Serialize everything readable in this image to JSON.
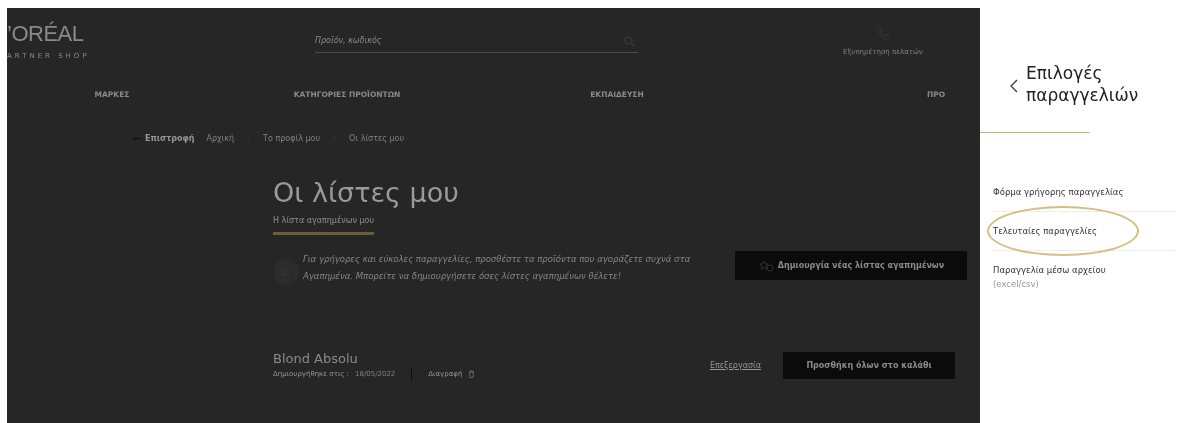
{
  "page": {
    "logo": {
      "brand": "’ORÉAL",
      "subtitle": "ARTNER SHOP"
    },
    "search": {
      "placeholder": "Προϊόν, κωδικός"
    },
    "customer_service": "Εξυπηρέτηση πελατών",
    "nav": [
      "ΜΑΡΚΕΣ",
      "ΚΑΤΗΓΟΡΙΕΣ ΠΡΟΪΟΝΤΩΝ",
      "ΕΚΠΑΙΔΕΥΣΗ",
      "ΠΡΟ"
    ],
    "back": "Επιστροφή",
    "breadcrumb": [
      "Αρχική",
      "Το προφίλ μου",
      "Οι λίστες μου"
    ],
    "title": "Οι λίστες μου",
    "tabs": [
      {
        "label": "Η λίστα αγαπημένων μου",
        "selected": true
      }
    ],
    "info": "Για γρήγορες και εύκολες παραγγελίες, προσθέστε τα προϊόντα που αγοράζετε συχνά στα Αγαπημένα. Μπορείτε να δημιουργήσετε όσες λίστες αγαπημένων θέλετε!",
    "create_button": "Δημιουργία νέας λίστας αγαπημένων",
    "lists": [
      {
        "name": "Blond Absolu",
        "created_label": "Δημιουργήθηκε στις :",
        "created_date": "18/05/2022",
        "delete": "Διαγραφή",
        "edit": "Επεξεργασία",
        "add_all": "Προσθήκη όλων στο καλάθι"
      }
    ]
  },
  "drawer": {
    "title": "Επιλογές παραγγελιών",
    "items": [
      {
        "label": "Φόρμα γρήγορης παραγγελίας",
        "selected": false
      },
      {
        "label": "Τελευταίες παραγγελίες",
        "selected": true
      },
      {
        "label": "Παραγγελία μέσω αρχείου",
        "note": "(excel/csv)",
        "selected": false
      }
    ]
  }
}
